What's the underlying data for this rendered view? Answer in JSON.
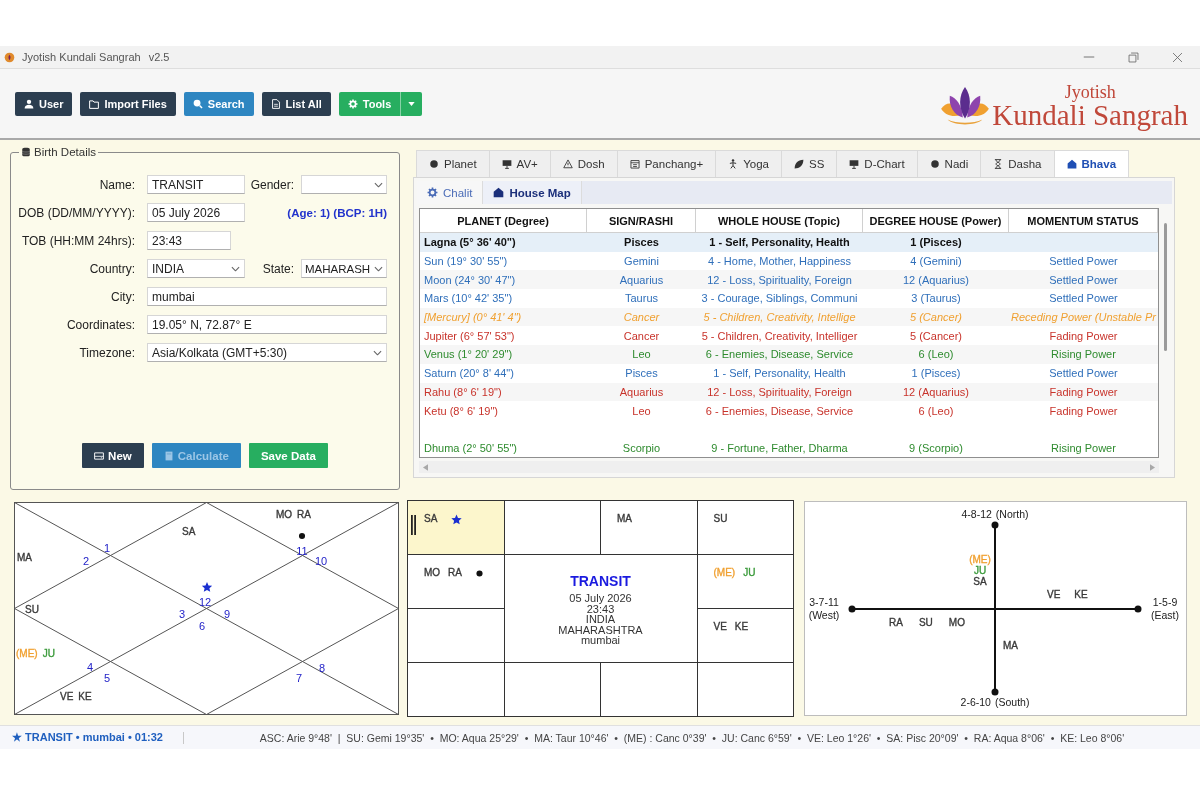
{
  "window": {
    "title": "Jyotish Kundali Sangrah",
    "version": "v2.5"
  },
  "toolbar": [
    {
      "label": "User",
      "kind": "user",
      "color": "#2c3e50",
      "dropdown": false
    },
    {
      "label": "Import Files",
      "kind": "import",
      "color": "#2c3e50",
      "dropdown": false
    },
    {
      "label": "Search",
      "kind": "search",
      "color": "#2e86c1",
      "dropdown": false
    },
    {
      "label": "List All",
      "kind": "list",
      "color": "#2c3e50",
      "dropdown": false
    },
    {
      "label": "Tools",
      "kind": "tools",
      "color": "#27ae60",
      "dropdown": true
    }
  ],
  "logo": {
    "top": "Jyotish",
    "bottom": "Kundali Sangrah"
  },
  "birth_details": {
    "title": "Birth Details",
    "rows": [
      {
        "label": "Name:",
        "kind": "input",
        "value": "TRANSIT",
        "side": {
          "kind": "select",
          "label": "Gender:"
        }
      },
      {
        "label": "DOB (DD/MM/YYYY):",
        "kind": "input",
        "value": "05 July 2026",
        "side": {
          "kind": "note",
          "text": "(Age: 1) (BCP: 1H)"
        }
      },
      {
        "label": "TOB (HH:MM 24hrs):",
        "kind": "input",
        "value": "23:43"
      },
      {
        "label": "Country:",
        "kind": "select",
        "value": "INDIA",
        "side": {
          "kind": "select",
          "label": "State:",
          "value": "MAHARASH"
        }
      },
      {
        "label": "City:",
        "kind": "input",
        "value": "mumbai"
      },
      {
        "label": "Coordinates:",
        "kind": "input",
        "value": "19.05° N, 72.87° E"
      },
      {
        "label": "Timezone:",
        "kind": "select",
        "value": "Asia/Kolkata (GMT+5:30)"
      }
    ],
    "buttons": [
      {
        "label": "New",
        "kind": "new",
        "color": "#2c3e50",
        "disabled": false
      },
      {
        "label": "Calculate",
        "kind": "calculate",
        "color": "#2e86c1",
        "disabled": true
      },
      {
        "label": "Save Data",
        "kind": "save",
        "color": "#27ae60",
        "disabled": false
      }
    ]
  },
  "tabs": [
    {
      "label": "Planet",
      "kind": "planet",
      "selected": false
    },
    {
      "label": "AV+",
      "kind": "av",
      "selected": false
    },
    {
      "label": "Dosh",
      "kind": "dosh",
      "selected": false
    },
    {
      "label": "Panchang+",
      "kind": "panchang",
      "selected": false
    },
    {
      "label": "Yoga",
      "kind": "yoga",
      "selected": false
    },
    {
      "label": "SS",
      "kind": "ss",
      "selected": false
    },
    {
      "label": "D-Chart",
      "kind": "dchart",
      "selected": false
    },
    {
      "label": "Nadi",
      "kind": "nadi",
      "selected": false
    },
    {
      "label": "Dasha",
      "kind": "dasha",
      "selected": false
    },
    {
      "label": "Bhava",
      "kind": "bhava",
      "selected": true
    }
  ],
  "subtabs": [
    {
      "label": "Chalit",
      "kind": "chalit",
      "selected": false
    },
    {
      "label": "House Map",
      "kind": "housemap",
      "selected": true
    }
  ],
  "house_table": {
    "columns": [
      "PLANET (Degree)",
      "SIGN/RASHI",
      "WHOLE HOUSE (Topic)",
      "DEGREE HOUSE (Power)",
      "MOMENTUM STATUS"
    ],
    "rows": [
      {
        "kind": "lagna",
        "color": "#111111",
        "cells": [
          "Lagna (5° 36' 40\")",
          "Pisces",
          "1 - Self, Personality, Health",
          "1 (Pisces)"
        ]
      },
      {
        "kind": "planet",
        "color": "#2f6fba",
        "cells": [
          "Sun (19° 30' 55\")",
          "Gemini",
          "4 - Home, Mother, Happiness",
          "4 (Gemini)",
          "Settled Power"
        ]
      },
      {
        "kind": "planet",
        "color": "#2f6fba",
        "cells": [
          "Moon (24° 30' 47\")",
          "Aquarius",
          "12 - Loss, Spirituality, Foreign",
          "12 (Aquarius)",
          "Settled Power"
        ]
      },
      {
        "kind": "planet",
        "color": "#2f6fba",
        "cells": [
          "Mars (10° 42' 35\")",
          "Taurus",
          "3 - Courage, Siblings, Communi",
          "3 (Taurus)",
          "Settled Power"
        ]
      },
      {
        "kind": "italic",
        "color": "#f0a030",
        "cells": [
          "[Mercury] (0° 41' 4\")",
          "Cancer",
          "5 - Children, Creativity, Intellige",
          "5 (Cancer)",
          "Receding Power (Unstable Pr"
        ]
      },
      {
        "kind": "planet",
        "color": "#c8332b",
        "cells": [
          "Jupiter (6° 57' 53\")",
          "Cancer",
          "5 - Children, Creativity, Intelliger",
          "5 (Cancer)",
          "Fading Power"
        ]
      },
      {
        "kind": "planet",
        "color": "#2e8b2e",
        "cells": [
          "Venus (1° 20' 29\")",
          "Leo",
          "6 - Enemies, Disease, Service",
          "6 (Leo)",
          "Rising Power"
        ]
      },
      {
        "kind": "planet",
        "color": "#2f6fba",
        "cells": [
          "Saturn (20° 8' 44\")",
          "Pisces",
          "1 - Self, Personality, Health",
          "1 (Pisces)",
          "Settled Power"
        ]
      },
      {
        "kind": "planet",
        "color": "#c8332b",
        "cells": [
          "Rahu (8° 6' 19\")",
          "Aquarius",
          "12 - Loss, Spirituality, Foreign",
          "12 (Aquarius)",
          "Fading Power"
        ]
      },
      {
        "kind": "planet",
        "color": "#c8332b",
        "cells": [
          "Ketu (8° 6' 19\")",
          "Leo",
          "6 - Enemies, Disease, Service",
          "6 (Leo)",
          "Fading Power"
        ]
      },
      {
        "kind": "blank"
      },
      {
        "kind": "planet",
        "color": "#2e8b2e",
        "cells": [
          "Dhuma (2° 50' 55\")",
          "Scorpio",
          "9 - Fortune, Father, Dharma",
          "9 (Scorpio)",
          "Rising Power"
        ]
      }
    ]
  },
  "north_chart": {
    "houses": [
      {
        "sign": "12",
        "kind": "star",
        "planets": [
          {
            "abbr": "SA",
            "color": "#3a3a3a"
          }
        ]
      },
      {
        "sign": "1",
        "kind": "plain"
      },
      {
        "sign": "2",
        "kind": "plain",
        "planets": [
          {
            "abbr": "MA",
            "color": "#3a3a3a"
          }
        ]
      },
      {
        "sign": "3",
        "kind": "plain",
        "planets": [
          {
            "abbr": "SU",
            "color": "#3a3a3a"
          }
        ]
      },
      {
        "sign": "4",
        "kind": "plain",
        "planets": [
          {
            "abbr": "(ME)",
            "color": "#f0a030"
          },
          {
            "abbr": "JU",
            "color": "#3a9a3a"
          }
        ]
      },
      {
        "sign": "5",
        "kind": "plain",
        "planets": [
          {
            "abbr": "VE",
            "color": "#3a3a3a"
          },
          {
            "abbr": "KE",
            "color": "#3a3a3a"
          }
        ]
      },
      {
        "sign": "6",
        "kind": "plain"
      },
      {
        "sign": "7",
        "kind": "plain"
      },
      {
        "sign": "8",
        "kind": "plain"
      },
      {
        "sign": "9",
        "kind": "plain"
      },
      {
        "sign": "10",
        "kind": "plain"
      },
      {
        "sign": "11",
        "kind": "dot",
        "planets": [
          {
            "abbr": "MO",
            "color": "#3a3a3a"
          },
          {
            "abbr": "RA",
            "color": "#3a3a3a"
          }
        ]
      }
    ]
  },
  "south_chart": {
    "cells": [
      {
        "highlighted": true,
        "kind": "star",
        "planets": [
          {
            "abbr": "SA",
            "color": "#3a3a3a"
          }
        ]
      },
      {
        "highlighted": false,
        "kind": "plain"
      },
      {
        "highlighted": false,
        "kind": "plain",
        "planets": [
          {
            "abbr": "MA",
            "color": "#3a3a3a"
          }
        ]
      },
      {
        "highlighted": false,
        "kind": "plain",
        "planets": [
          {
            "abbr": "SU",
            "color": "#3a3a3a"
          }
        ]
      },
      {
        "highlighted": false,
        "kind": "plain",
        "planets": [
          {
            "abbr": "(ME)",
            "color": "#f0a030"
          },
          {
            "abbr": "JU",
            "color": "#3a9a3a"
          }
        ]
      },
      {
        "highlighted": false,
        "kind": "plain",
        "planets": [
          {
            "abbr": "VE",
            "color": "#3a3a3a"
          },
          {
            "abbr": "KE",
            "color": "#3a3a3a"
          }
        ]
      },
      {
        "highlighted": false,
        "kind": "plain"
      },
      {
        "highlighted": false,
        "kind": "plain"
      },
      {
        "highlighted": false,
        "kind": "plain"
      },
      {
        "highlighted": false,
        "kind": "plain"
      },
      {
        "highlighted": false,
        "kind": "plain"
      },
      {
        "highlighted": false,
        "kind": "dot",
        "planets": [
          {
            "abbr": "MO",
            "color": "#3a3a3a"
          },
          {
            "abbr": "RA",
            "color": "#3a3a3a"
          }
        ]
      }
    ],
    "center": {
      "title": "TRANSIT",
      "lines": [
        "05 July 2026",
        "23:43",
        "INDIA",
        "MAHARASHTRA",
        "mumbai"
      ]
    }
  },
  "cardinal_chart": {
    "directions": [
      {
        "houses": "4-8-12",
        "name": "(North)",
        "planets": [
          {
            "abbr": "(ME)",
            "color": "#f0a030"
          },
          {
            "abbr": "JU",
            "color": "#3a9a3a"
          },
          {
            "abbr": "SA",
            "color": "#3a3a3a"
          }
        ]
      },
      {
        "houses": "3-7-11",
        "name": "(West)",
        "planets": [
          {
            "abbr": "RA",
            "color": "#3a3a3a"
          },
          {
            "abbr": "SU",
            "color": "#3a3a3a"
          },
          {
            "abbr": "MO",
            "color": "#3a3a3a"
          }
        ]
      },
      {
        "houses": "1-5-9",
        "name": "(East)",
        "planets": [
          {
            "abbr": "VE",
            "color": "#3a3a3a"
          },
          {
            "abbr": "KE",
            "color": "#3a3a3a"
          }
        ]
      },
      {
        "houses": "2-6-10",
        "name": "(South)",
        "planets": [
          {
            "abbr": "MA",
            "color": "#3a3a3a"
          }
        ]
      }
    ]
  },
  "status_bar": {
    "chart": "★ TRANSIT • mumbai • 01:32",
    "positions": "ASC: Arie 9°48'  |  SU: Gemi 19°35'  •  MO: Aqua 25°29'  •  MA: Taur 10°46'  •  (ME) : Canc 0°39'  •  JU: Canc 6°59'  •  VE: Leo 1°26'  •  SA: Pisc 20°09'  •  RA: Aqua 8°06'  •  KE: Leo 8°06'"
  }
}
